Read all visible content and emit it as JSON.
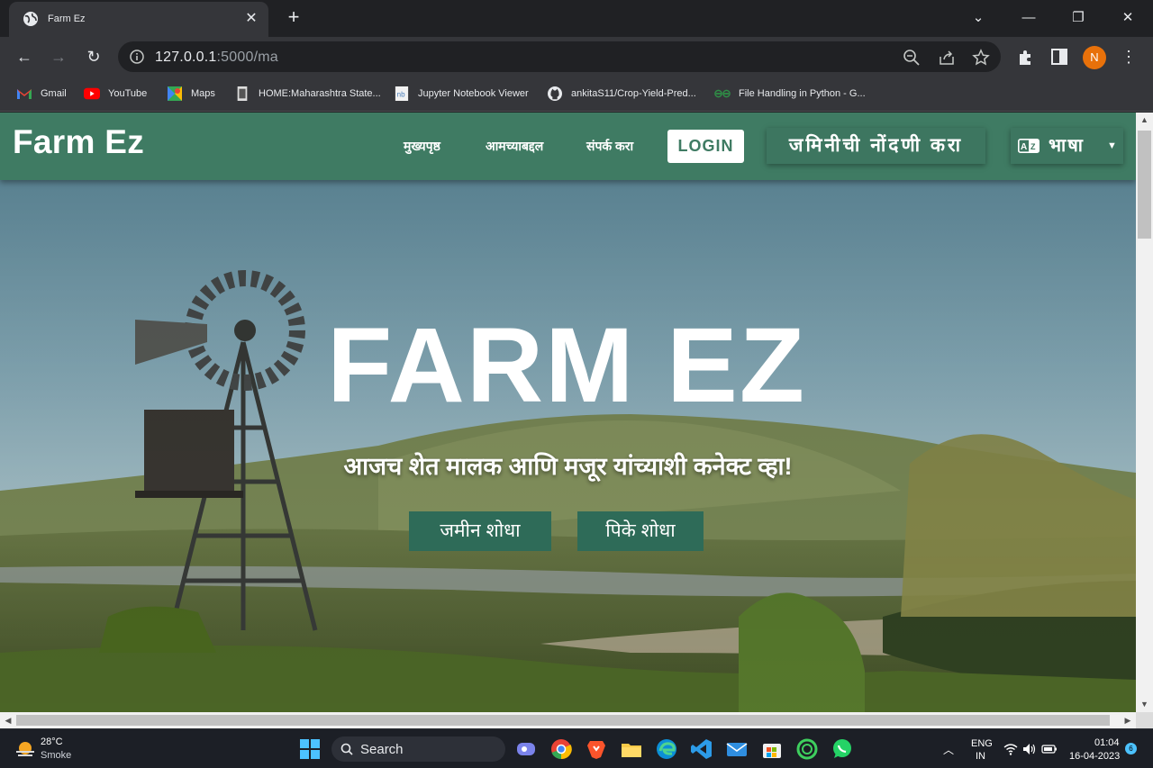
{
  "browser": {
    "tab_title": "Farm Ez",
    "url_host": "127.0.0.1",
    "url_rest": ":5000/ma",
    "profile_initial": "N",
    "bookmarks": [
      {
        "label": "Gmail",
        "icon": "gmail-icon"
      },
      {
        "label": "YouTube",
        "icon": "youtube-icon"
      },
      {
        "label": "Maps",
        "icon": "maps-icon"
      },
      {
        "label": "HOME:Maharashtra State...",
        "icon": "maharashtra-icon"
      },
      {
        "label": "Jupyter Notebook Viewer",
        "icon": "jupyter-icon"
      },
      {
        "label": "ankitaS11/Crop-Yield-Pred...",
        "icon": "github-icon"
      },
      {
        "label": "File Handling in Python - G...",
        "icon": "geeksforgeeks-icon"
      }
    ]
  },
  "site": {
    "brand": "Farm Ez",
    "nav": {
      "home": "मुख्यपृष्ठ",
      "about": "आमच्याबद्दल",
      "contact": "संपर्क करा",
      "login": "LOGIN",
      "register": "जमिनीची नोंदणी करा",
      "language": "भाषा"
    },
    "hero": {
      "title": "FARM EZ",
      "subtitle": "आजच शेत मालक आणि मजूर यांच्याशी कनेक्ट व्हा!",
      "find_land": "जमीन शोधा",
      "find_crops": "पिके शोधा"
    },
    "colors": {
      "navbar": "#3f7b63",
      "cta": "#2e6b58"
    }
  },
  "taskbar": {
    "temperature": "28°C",
    "condition": "Smoke",
    "search_label": "Search",
    "lang_line1": "ENG",
    "lang_line2": "IN",
    "time": "01:04",
    "date": "16-04-2023",
    "notification_count": "6"
  }
}
